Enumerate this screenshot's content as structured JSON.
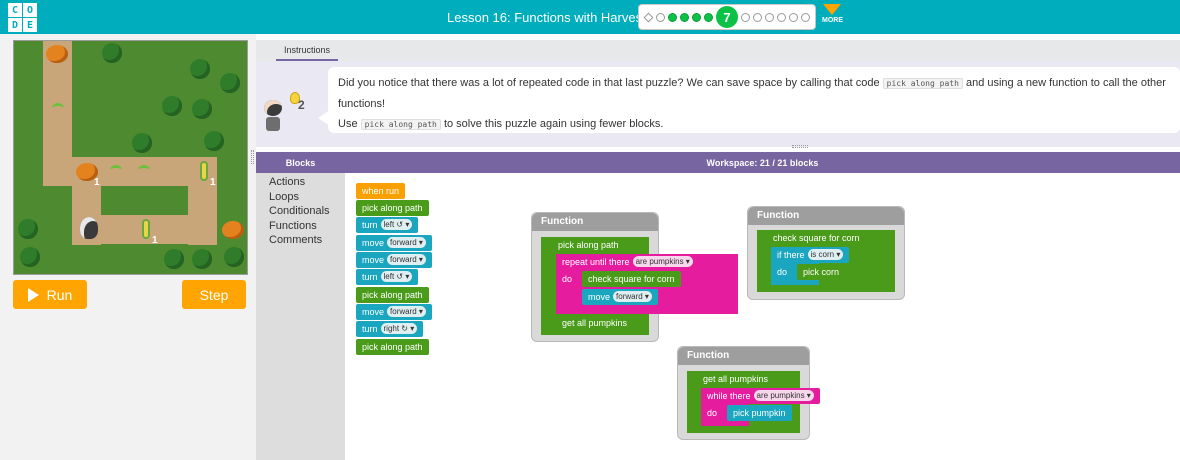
{
  "header": {
    "logo_letters": [
      "C",
      "O",
      "D",
      "E"
    ],
    "lesson_title": "Lesson 16: Functions with Harvester",
    "current_level": "7",
    "more_label": "MORE",
    "accent_color": "#00adbc"
  },
  "controls": {
    "run_label": "Run",
    "step_label": "Step"
  },
  "maze": {
    "counts": [
      "1",
      "1",
      "1"
    ]
  },
  "instructions": {
    "tab_label": "Instructions",
    "hint_count": "2",
    "text_before_code": "Did you notice that there was a lot of repeated code in that last puzzle? We can save space by calling that code",
    "code_1": "pick along path",
    "text_after_code": "and using a new function to call the other functions!",
    "line2_prefix": "Use",
    "code_2": "pick along path",
    "line2_suffix": "to solve this puzzle again using fewer blocks."
  },
  "blocks_header": "Blocks",
  "workspace_header": "Workspace: 21 / 21 blocks",
  "toolbox": [
    "Actions",
    "Loops",
    "Conditionals",
    "Functions",
    "Comments"
  ],
  "main_program": {
    "when_run": "when run",
    "pick1": "pick along path",
    "turn1": "turn",
    "turn1_dir": "left ↺ ▾",
    "move1": "move",
    "move1_dir": "forward ▾",
    "move2": "move",
    "move2_dir": "forward ▾",
    "turn2": "turn",
    "turn2_dir": "left ↺ ▾",
    "pick2": "pick along path",
    "move3": "move",
    "move3_dir": "forward ▾",
    "turn3": "turn",
    "turn3_dir": "right ↻ ▾",
    "pick3": "pick along path"
  },
  "fn_pick": {
    "title": "Function",
    "name": "pick along path",
    "repeat_until": "repeat until",
    "there": "there",
    "condition": "are pumpkins ▾",
    "do": "do",
    "call_check": "check square for corn",
    "move": "move",
    "move_dir": "forward ▾",
    "call_get": "get all pumpkins"
  },
  "fn_corn": {
    "title": "Function",
    "name": "check square for corn",
    "if": "if",
    "there": "there",
    "condition": "is corn ▾",
    "do": "do",
    "action": "pick corn"
  },
  "fn_pumpkins": {
    "title": "Function",
    "name": "get all pumpkins",
    "while": "while",
    "there": "there",
    "condition": "are pumpkins ▾",
    "do": "do",
    "action": "pick pumpkin"
  }
}
